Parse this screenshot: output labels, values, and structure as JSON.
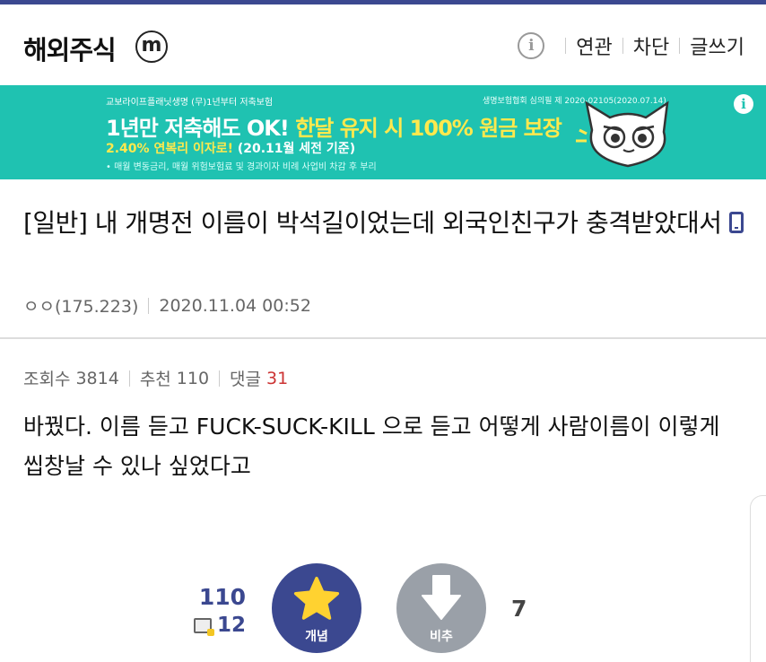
{
  "header": {
    "gallery_name": "해외주식",
    "minor_badge": "m",
    "info_icon_glyph": "i",
    "links": [
      "연관",
      "차단",
      "글쓰기"
    ]
  },
  "ad": {
    "small_left": "교보라이프플래닛생명 (무)1년부터 저축보험",
    "small_right": "생명보험협회 심의필 제 2020-02105(2020.07.14)",
    "headline_part1": "1년만 저축해도 OK!",
    "headline_part2": "한달 유지 시 100% 원금 보장",
    "sub_part1": "2.40% 연복리 이자로!",
    "sub_part2": "(20.11월 세전 기준)",
    "disclaimer": "• 매월 변동금리, 매월 위험보험료 및 경과이자 비례 사업비 차감 후 부리",
    "info_glyph": "i",
    "accent_color": "#1fc2b1",
    "highlight_color": "#ffe94d"
  },
  "post": {
    "title": "[일반] 내 개명전 이름이 박석길이었는데 외국인친구가 충격받았대서",
    "author": "ㅇㅇ(175.223)",
    "datetime": "2020.11.04 00:52",
    "views_label": "조회수",
    "views": "3814",
    "recommend_label": "추천",
    "recommend": "110",
    "comments_label": "댓글",
    "comments": "31",
    "body": "바꿨다. 이름 듣고 FUCK-SUCK-KILL 으로 듣고 어떻게 사람이름이 이렇게 씹창날 수 있나 싶었다고"
  },
  "vote": {
    "up_count": "110",
    "fixed_count": "12",
    "up_label": "개념",
    "down_label": "비추",
    "down_count": "7",
    "brand_color": "#3b4890"
  }
}
